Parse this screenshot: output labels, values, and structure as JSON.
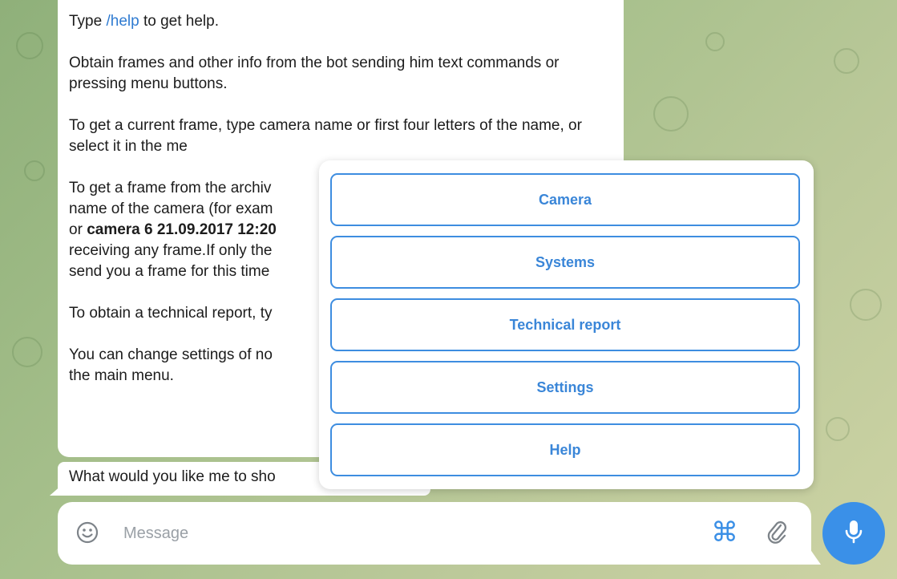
{
  "chat": {
    "help_prefix": "Type ",
    "help_link": "/help",
    "help_suffix": " to get help.",
    "para2": "Obtain frames and other info from the bot sending him text commands or pressing menu buttons.",
    "para3": "To get a current frame, type camera name or first four letters of the name, or select it in the me",
    "para4_a": "To get a frame from the archiv",
    "para4_b": "name of the camera (for exam",
    "para4_c_pre": "or ",
    "para4_c_bold": "camera 6 21.09.2017 12:20",
    "para4_d": "receiving any frame.If only the",
    "para4_e": "send you a frame for this time",
    "para5": "To obtain a technical report, ty",
    "para6_a": "You can change settings of no",
    "para6_b": "the main menu.",
    "second_message": "What would you like me to sho"
  },
  "menu": {
    "buttons": [
      "Camera",
      "Systems",
      "Technical report",
      "Settings",
      "Help"
    ]
  },
  "composer": {
    "placeholder": "Message",
    "cmd_glyph": "⌘"
  },
  "colors": {
    "accent": "#3a90e8",
    "link": "#2f7bd1",
    "button_text": "#3a86d8"
  }
}
